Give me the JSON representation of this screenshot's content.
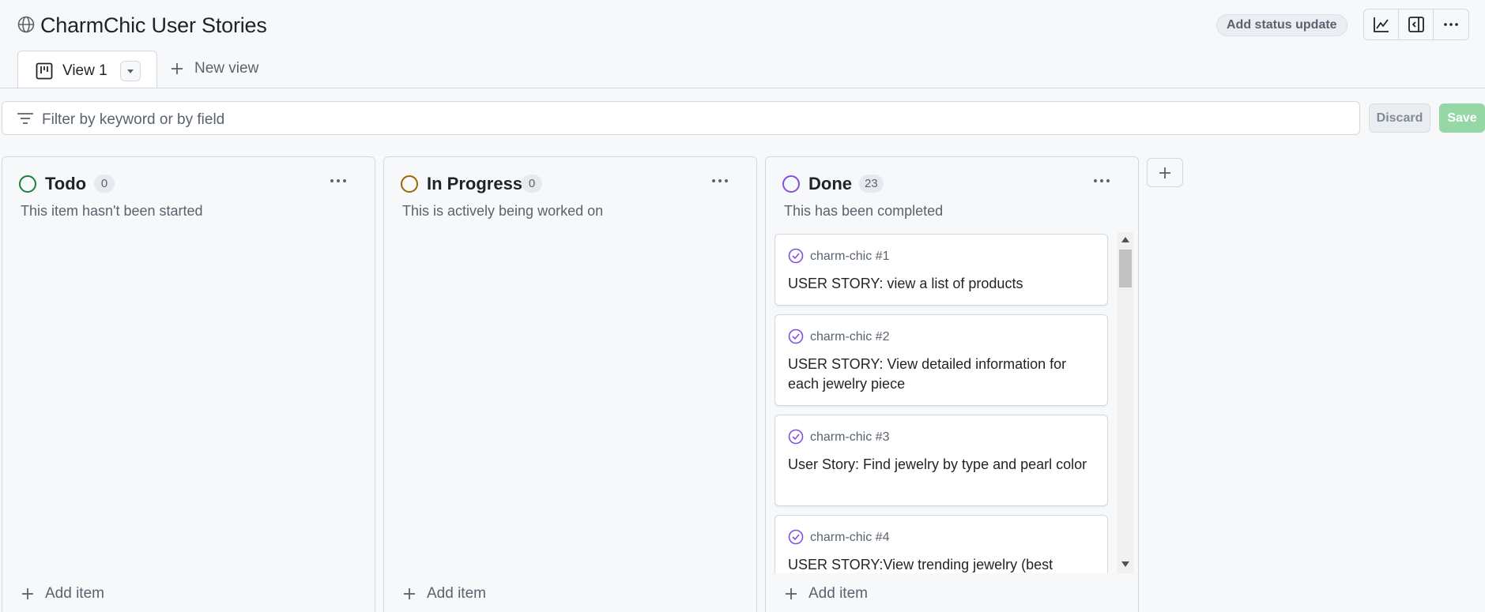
{
  "project": {
    "title": "CharmChic User Stories",
    "status_update_label": "Add status update"
  },
  "toolbar_icons": [
    "insights-graph-icon",
    "sidebar-collapse-icon",
    "kebab-horizontal-icon"
  ],
  "tabs": [
    {
      "label": "View 1",
      "icon": "board-icon",
      "active": true
    }
  ],
  "new_view_label": "New view",
  "filter": {
    "placeholder": "Filter by keyword or by field"
  },
  "actions": {
    "discard_label": "Discard",
    "save_label": "Save"
  },
  "columns": [
    {
      "name": "Todo",
      "count": "0",
      "description": "This item hasn't been started",
      "color": "#1a7f37",
      "add_label": "Add item",
      "cards": []
    },
    {
      "name": "In Progress",
      "count": "0",
      "description": "This is actively being worked on",
      "color": "#9a6700",
      "add_label": "Add item",
      "cards": []
    },
    {
      "name": "Done",
      "count": "23",
      "description": "This has been completed",
      "color": "#8250df",
      "add_label": "Add item",
      "cards": [
        {
          "ref": "charm-chic #1",
          "title": "USER STORY: view a list of products"
        },
        {
          "ref": "charm-chic #2",
          "title": "USER STORY: View detailed information for each jewelry piece"
        },
        {
          "ref": "charm-chic #3",
          "title": "User Story: Find jewelry by type and pearl color"
        },
        {
          "ref": "charm-chic #4",
          "title": "USER STORY:View trending jewelry (best"
        }
      ]
    }
  ],
  "colors": {
    "done_purple": "#8250df",
    "todo_green": "#1a7f37",
    "progress_yellow": "#9a6700",
    "save_green": "#95d8a6"
  }
}
